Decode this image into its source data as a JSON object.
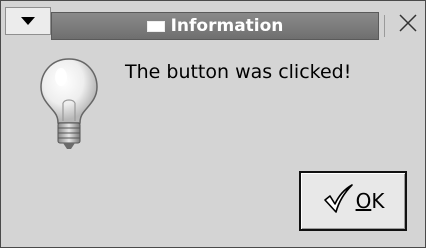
{
  "window": {
    "title": "Information",
    "icons": {
      "menu": "triangle-down-icon",
      "title": "window-icon",
      "close": "close-icon"
    }
  },
  "dialog": {
    "message": "The button was clicked!",
    "icon": "lightbulb-icon",
    "ok_button": {
      "mnemonic": "O",
      "rest": "K",
      "icon": "checkmark-icon"
    }
  },
  "colors": {
    "titlebar": "#7c7c7c",
    "background": "#d4d4d4",
    "title_text": "#ffffff"
  }
}
